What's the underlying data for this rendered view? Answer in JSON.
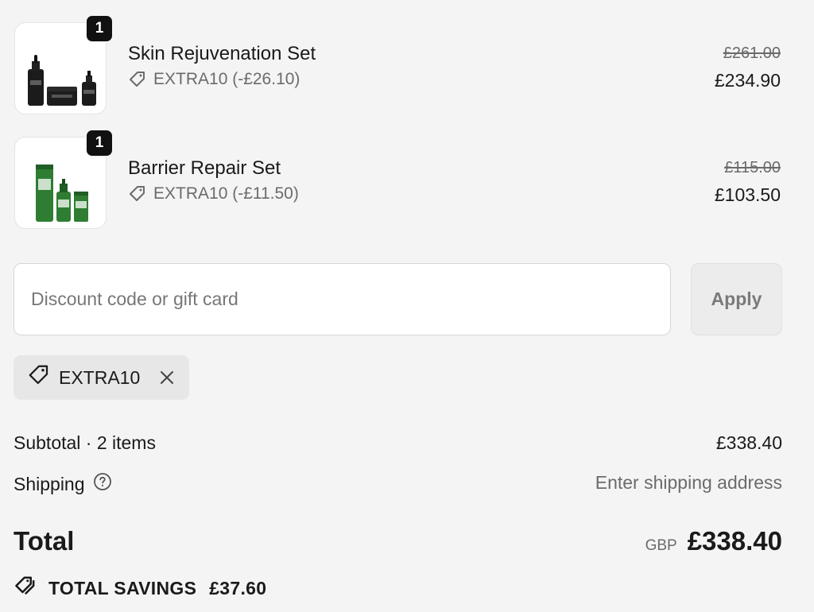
{
  "items": [
    {
      "name": "Skin Rejuvenation Set",
      "quantity": "1",
      "discount": "EXTRA10 (-£26.10)",
      "original_price": "£261.00",
      "price": "£234.90",
      "image_icon": "product-dark-bottles"
    },
    {
      "name": "Barrier Repair Set",
      "quantity": "1",
      "discount": "EXTRA10 (-£11.50)",
      "original_price": "£115.00",
      "price": "£103.50",
      "image_icon": "product-green-bottles"
    }
  ],
  "discount_form": {
    "placeholder": "Discount code or gift card",
    "value": "",
    "apply_label": "Apply"
  },
  "applied_code": {
    "code": "EXTRA10",
    "icon": "tag-icon",
    "remove_icon": "close-icon"
  },
  "summary": {
    "subtotal_label": "Subtotal · 2 items",
    "subtotal_value": "£338.40",
    "shipping_label": "Shipping",
    "shipping_value": "Enter shipping address",
    "total_label": "Total",
    "currency": "GBP",
    "total_value": "£338.40",
    "savings_label": "TOTAL SAVINGS",
    "savings_value": "£37.60"
  },
  "colors": {
    "background": "#f4f4f4",
    "text": "#1a1a1a",
    "muted": "#6b6b6b",
    "badge": "#111111",
    "dark_product": "#1b1b1b",
    "green_product": "#2e7d32"
  }
}
